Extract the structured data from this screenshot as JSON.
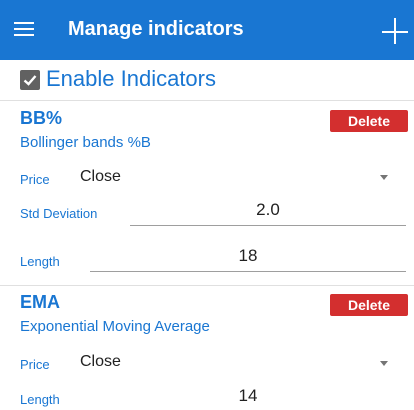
{
  "appbar": {
    "title": "Manage indicators"
  },
  "enable": {
    "label": "Enable Indicators",
    "checked": true
  },
  "indicators": [
    {
      "title": "BB%",
      "description": "Bollinger bands %B",
      "delete_label": "Delete",
      "price_label": "Price",
      "price_value": "Close",
      "std_label": "Std Deviation",
      "std_value": "2.0",
      "length_label": "Length",
      "length_value": "18"
    },
    {
      "title": "EMA",
      "description": "Exponential Moving Average",
      "delete_label": "Delete",
      "price_label": "Price",
      "price_value": "Close",
      "length_label": "Length",
      "length_value": "14"
    }
  ],
  "colors": {
    "primary": "#1976d2",
    "delete": "#d32f2f",
    "checkbox": "#616161"
  }
}
